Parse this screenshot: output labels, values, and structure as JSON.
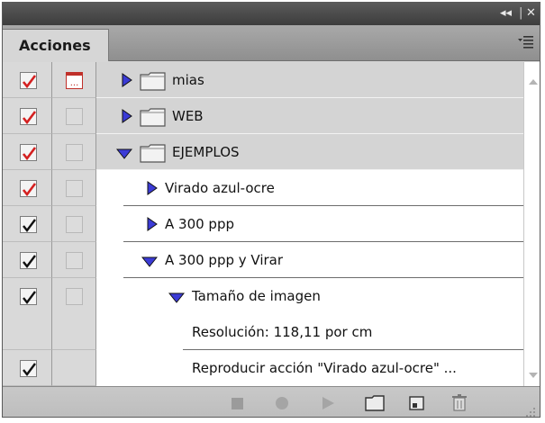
{
  "window": {
    "collapse_icon": "double-chevron-left-icon",
    "close_icon": "close-icon",
    "collapse_glyph": "◂◂",
    "close_glyph": "✕"
  },
  "panel": {
    "tab_label": "Acciones",
    "menu_icon": "panel-menu-icon"
  },
  "rows": [
    {
      "label": "mias",
      "type": "set",
      "expanded": false,
      "check_color": "#d42020",
      "dialog": true
    },
    {
      "label": "WEB",
      "type": "set",
      "expanded": false,
      "check_color": "#d42020",
      "dialog": false
    },
    {
      "label": "EJEMPLOS",
      "type": "set",
      "expanded": true,
      "check_color": "#d42020",
      "dialog": false
    },
    {
      "label": "Virado azul-ocre",
      "type": "action",
      "expanded": false,
      "check_color": "#d42020",
      "dialog": false
    },
    {
      "label": "A 300 ppp",
      "type": "action",
      "expanded": false,
      "check_color": "#111111",
      "dialog": false
    },
    {
      "label": "A 300 ppp y Virar",
      "type": "action",
      "expanded": true,
      "check_color": "#111111",
      "dialog": false
    },
    {
      "label": "Tamaño de imagen",
      "type": "command",
      "expanded": true,
      "check_color": "#111111",
      "dialog": false
    },
    {
      "label": "Resolución: 118,11 por cm",
      "type": "detail"
    },
    {
      "label": "Reproducir acción \"Virado azul-ocre\" ...",
      "type": "command",
      "expanded": null,
      "check_color": "#111111",
      "dialog": false
    }
  ],
  "toolbar": [
    {
      "name": "stop-button",
      "icon": "stop-icon"
    },
    {
      "name": "record-button",
      "icon": "record-icon"
    },
    {
      "name": "play-button",
      "icon": "play-icon"
    },
    {
      "name": "new-set-button",
      "icon": "folder-icon"
    },
    {
      "name": "new-action-button",
      "icon": "new-item-icon"
    },
    {
      "name": "delete-button",
      "icon": "trash-icon"
    }
  ],
  "colors": {
    "triangle_fill": "#3b3bd6",
    "checked_red": "#d42020",
    "dialog_red": "#c0302a"
  }
}
